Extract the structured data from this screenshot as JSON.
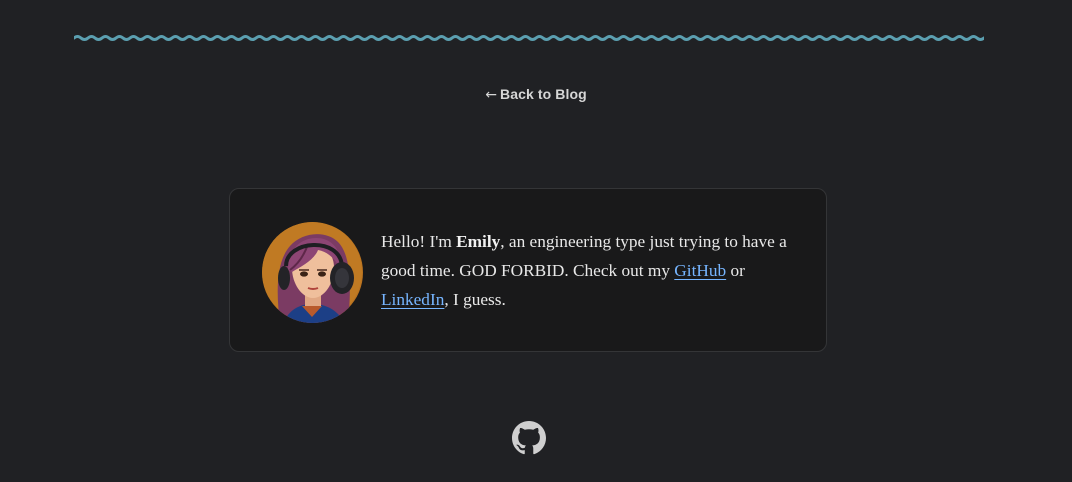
{
  "nav": {
    "back_arrow": "←",
    "back_label": "Back to Blog"
  },
  "bio": {
    "greeting": "Hello! I'm ",
    "name": "Emily",
    "text_1": ", an engineering type just trying to have a good time. GOD FORBID. Check out my ",
    "github_label": "GitHub",
    "text_2": " or ",
    "linkedin_label": "LinkedIn",
    "text_3": ", I guess."
  },
  "footer": {
    "icon": "github-icon"
  },
  "colors": {
    "background": "#202124",
    "card": "#19191a",
    "wave": "#5b9fb0",
    "link": "#76b5ff"
  }
}
